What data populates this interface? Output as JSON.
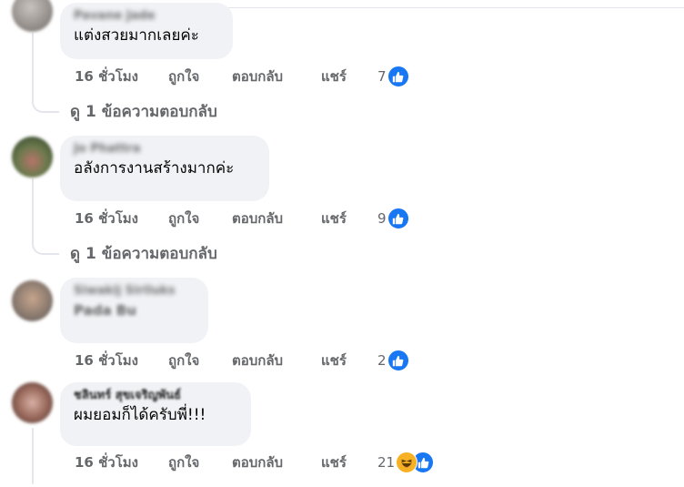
{
  "comments": [
    {
      "author": "Pavane Jade",
      "text": "แต่งสวยมากเลยค่ะ",
      "time": "16 ชั่วโมง",
      "like": "ถูกใจ",
      "reply": "ตอบกลับ",
      "share": "แชร์",
      "reactions": "7",
      "replies_link": "ดู 1 ข้อความตอบกลับ"
    },
    {
      "author": "Jo Phattra",
      "text": "อลังการงานสร้างมากค่ะ",
      "time": "16 ชั่วโมง",
      "like": "ถูกใจ",
      "reply": "ตอบกลับ",
      "share": "แชร์",
      "reactions": "9",
      "replies_link": "ดู 1 ข้อความตอบกลับ"
    },
    {
      "author": "Siwakij Siriluks",
      "text": "Pada Bu",
      "time": "16 ชั่วโมง",
      "like": "ถูกใจ",
      "reply": "ตอบกลับ",
      "share": "แชร์",
      "reactions": "2"
    },
    {
      "author": "ชลินทร์ สุขเจริญพันธ์",
      "text": "ผมยอมก็ได้ครับพี่!!!",
      "time": "16 ชั่วโมง",
      "like": "ถูกใจ",
      "reply": "ตอบกลับ",
      "share": "แชร์",
      "reactions": "21"
    }
  ],
  "colors": {
    "bubble": "#f0f2f5",
    "meta_text": "#65676b",
    "like_blue": "#1877f2",
    "haha_yellow": "#f7b125"
  },
  "icons": [
    "like-reaction-icon",
    "haha-reaction-icon"
  ]
}
